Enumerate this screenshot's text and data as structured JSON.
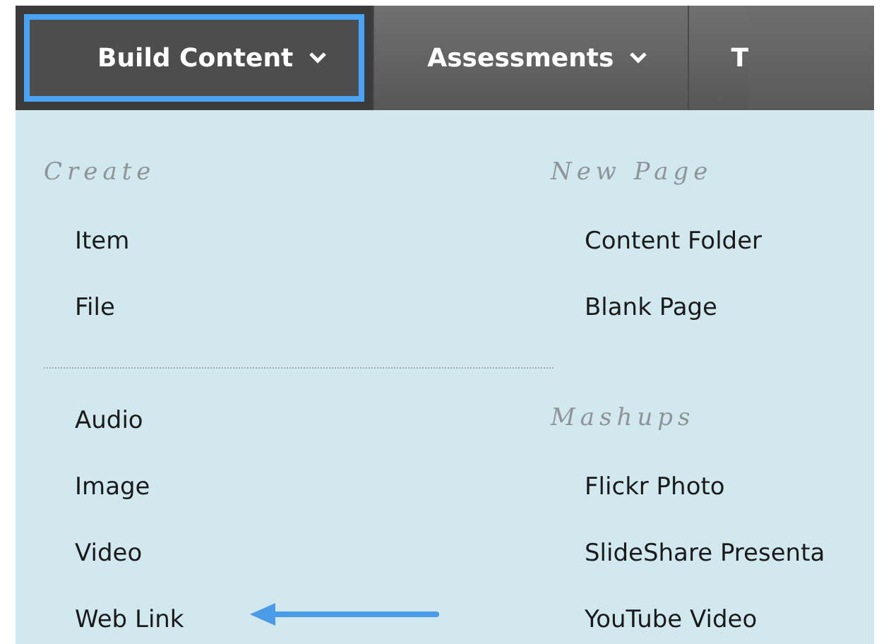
{
  "tabs": [
    {
      "label": "Build Content",
      "selected": true,
      "caret": true
    },
    {
      "label": "Assessments",
      "selected": false,
      "caret": true
    },
    {
      "label": "T",
      "selected": false,
      "caret": false
    }
  ],
  "menu": {
    "columns": [
      {
        "sections": [
          {
            "heading": "Create",
            "items": [
              "Item",
              "File"
            ]
          },
          {
            "items": [
              "Audio",
              "Image",
              "Video",
              "Web Link"
            ]
          }
        ]
      },
      {
        "sections": [
          {
            "heading": "New Page",
            "items": [
              "Content Folder",
              "Blank Page"
            ]
          },
          {
            "heading": "Mashups",
            "items": [
              "Flickr Photo",
              "SlideShare Presenta",
              "YouTube Video"
            ]
          }
        ]
      }
    ]
  }
}
